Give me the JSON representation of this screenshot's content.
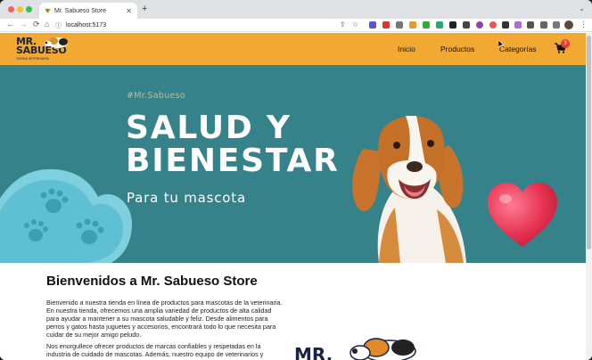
{
  "browser": {
    "tab_title": "Mr. Sabueso Store",
    "close_glyph": "✕",
    "new_tab_glyph": "+",
    "tab_menu_glyph": "⌄",
    "url": "localhost:5173",
    "back_glyph": "←",
    "forward_glyph": "→",
    "reload_glyph": "⟳",
    "home_glyph": "⌂",
    "info_glyph": "ⓘ",
    "share_glyph": "⇪",
    "bookmark_glyph": "☆",
    "menu_glyph": "⋮",
    "traffic_colors": [
      "#fe5f57",
      "#febc2e",
      "#28c840"
    ]
  },
  "header": {
    "logo_line1": "MR.",
    "logo_line2": "SABUESO",
    "logo_sub": "TIENDA VETERINARIA",
    "nav": [
      "Inicio",
      "Productos",
      "Categorías"
    ],
    "cart_count": "3",
    "bg_color": "#f2a934"
  },
  "hero": {
    "hashtag": "#Mr.Sabueso",
    "headline_line1": "SALUD Y",
    "headline_line2": "BIENESTAR",
    "subheadline": "Para tu mascota",
    "bg_color": "#35828a"
  },
  "intro": {
    "title": "Bienvenidos a Mr. Sabueso Store",
    "paragraph1_lines": [
      "Bienvenido a nuestra tienda en línea de productos para mascotas de la veterinaria.",
      "En nuestra tienda, ofrecemos una amplia variedad de productos de alta calidad",
      "para ayudar a mantener a su mascota saludable y feliz. Desde alimentos para",
      "perros y gatos hasta juguetes y accesorios, encontrará todo lo que necesita para",
      "cuidar de su mejor amigo peludo."
    ],
    "paragraph2_lines": [
      "Nos enorgullece ofrecer productos de marcas confiables y respetadas en la",
      "industria de cuidado de mascotas. Además, nuestro equipo de veterinarios y"
    ],
    "bottom_logo_text": "MR."
  }
}
